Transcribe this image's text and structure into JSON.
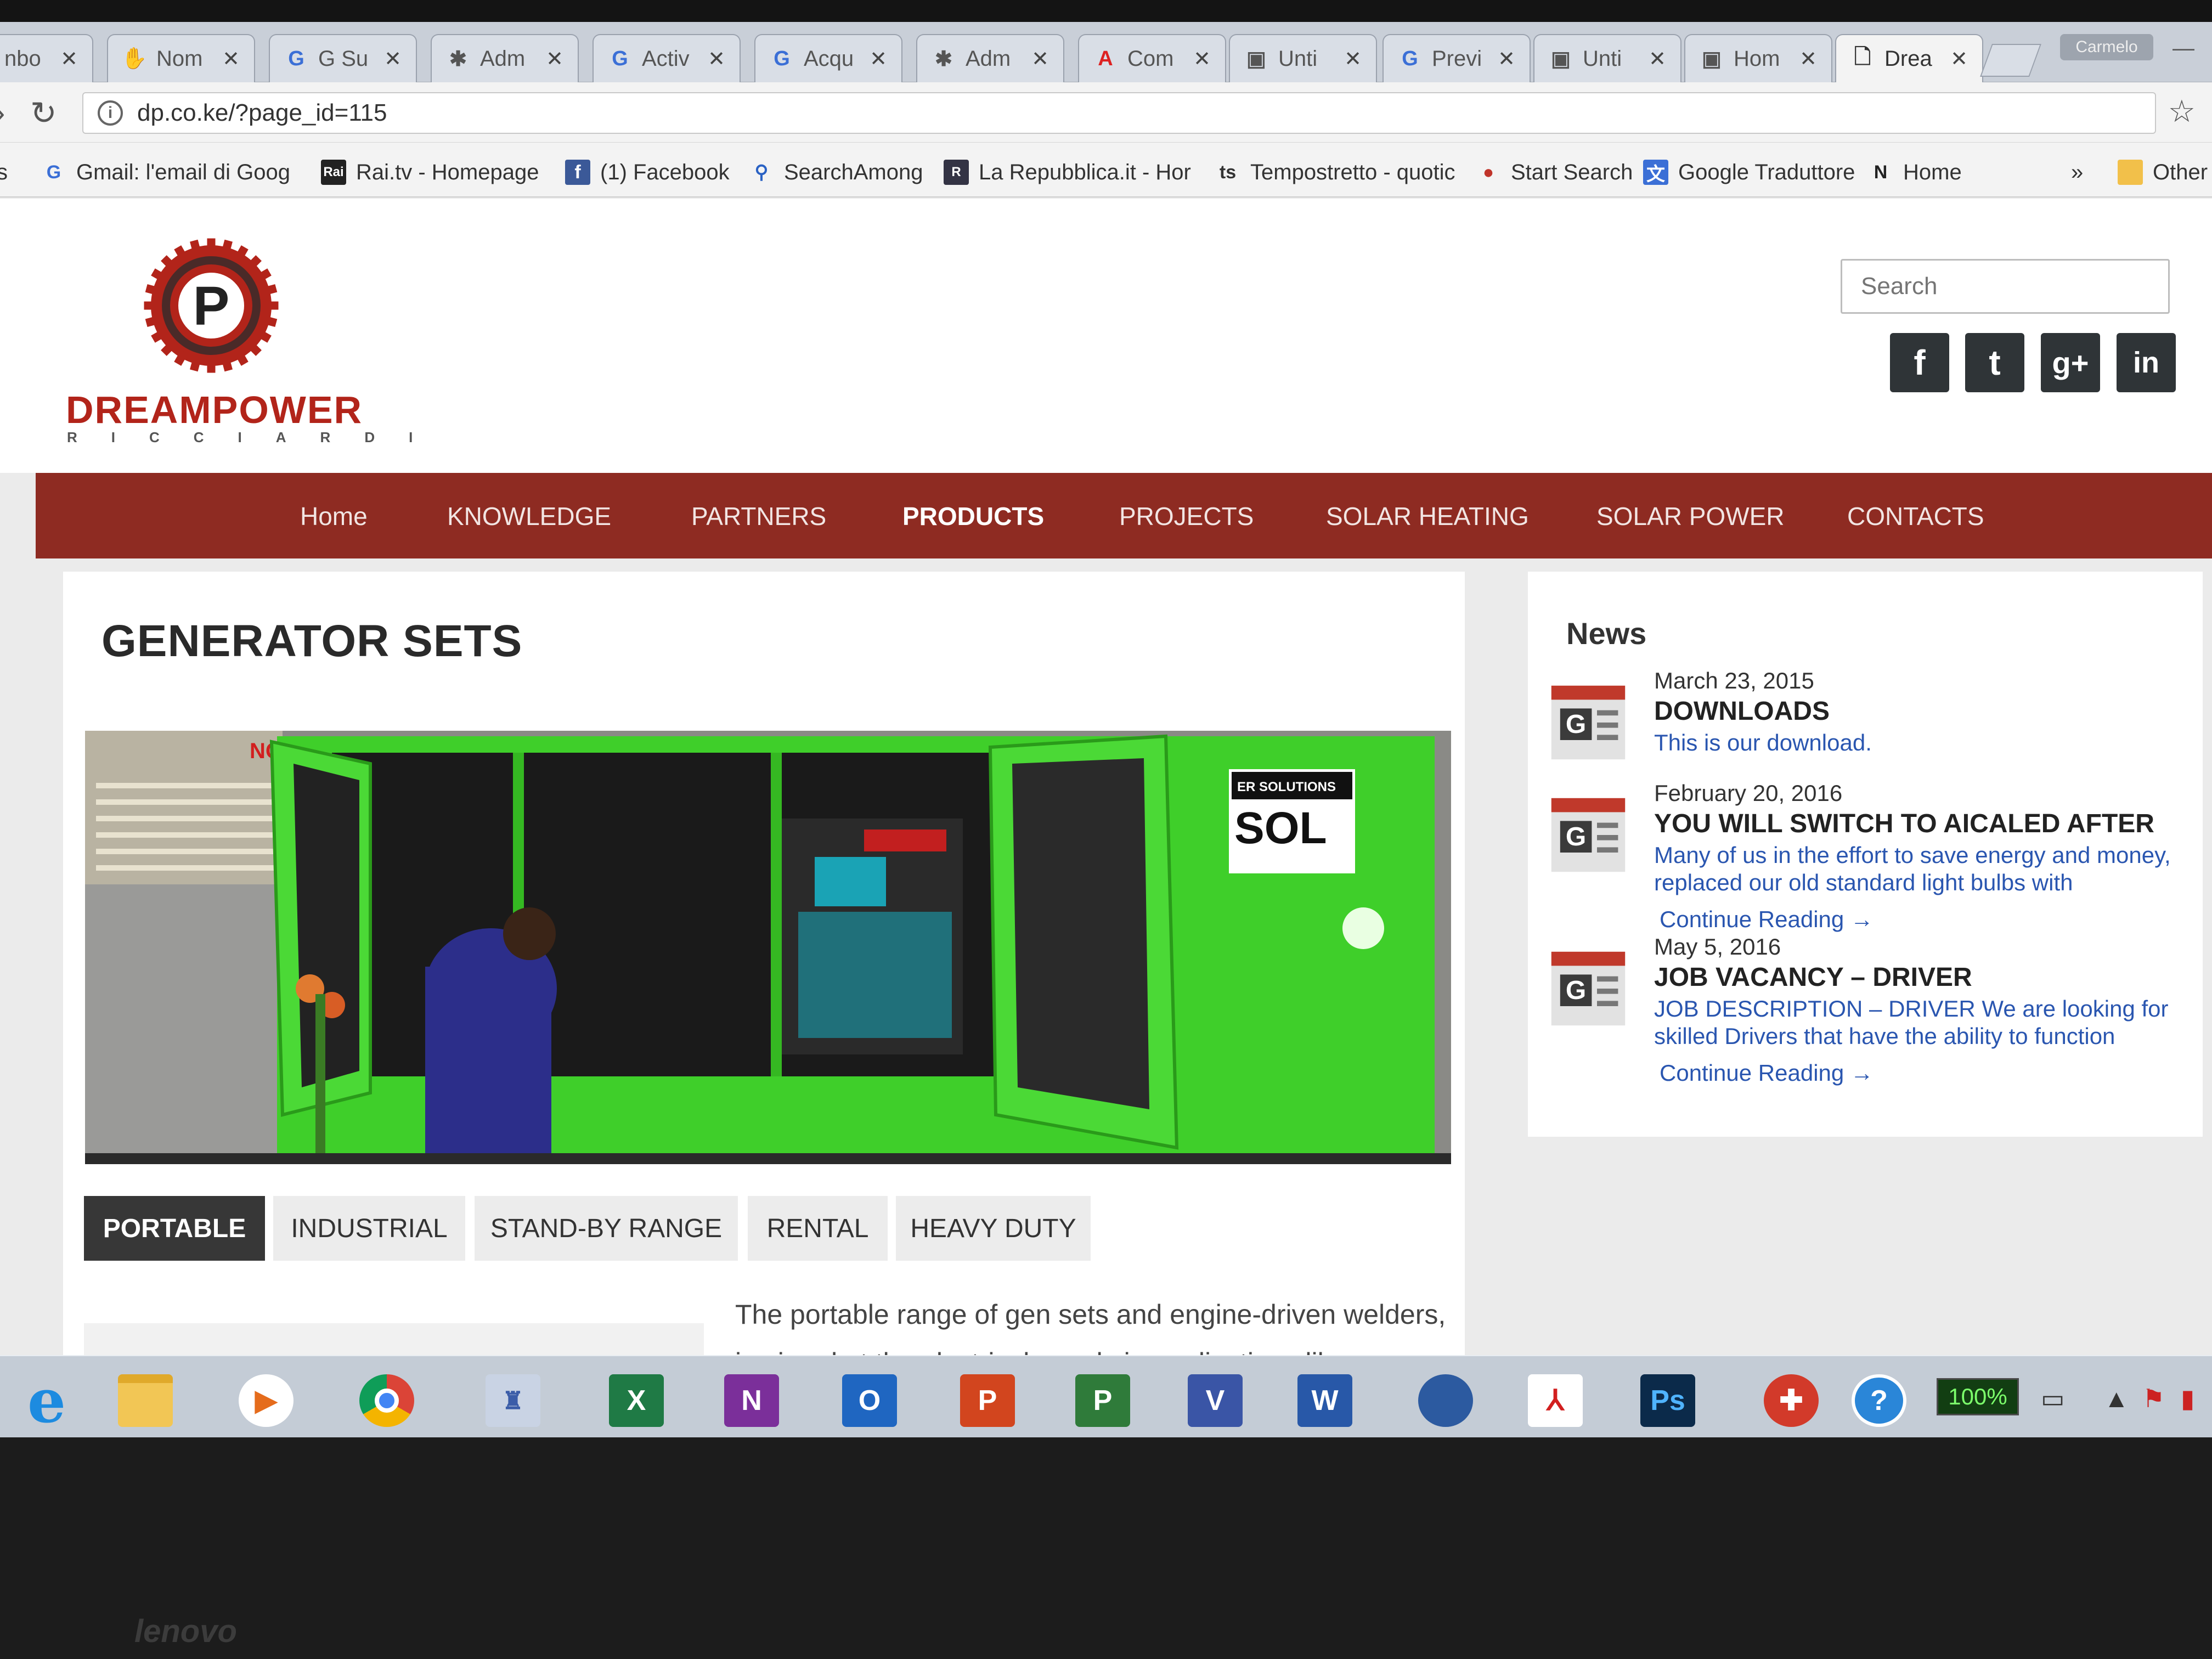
{
  "browser": {
    "tabs": [
      {
        "label": "nbo",
        "icon": "mail-icon"
      },
      {
        "label": "Nom",
        "icon": "puzzle-icon"
      },
      {
        "label": "G Su",
        "icon": "google-icon"
      },
      {
        "label": "Adm",
        "icon": "joomla-icon"
      },
      {
        "label": "Activ",
        "icon": "google-icon"
      },
      {
        "label": "Acqu",
        "icon": "google-icon"
      },
      {
        "label": "Adm",
        "icon": "joomla-icon"
      },
      {
        "label": "Com",
        "icon": "acrobat-icon"
      },
      {
        "label": "Unti",
        "icon": "page-icon"
      },
      {
        "label": "Previ",
        "icon": "google-icon"
      },
      {
        "label": "Unti",
        "icon": "page-icon"
      },
      {
        "label": "Hom",
        "icon": "page-icon"
      },
      {
        "label": "Drea",
        "icon": "document-icon"
      }
    ],
    "profile": "Carmelo",
    "url": "dp.co.ke/?page_id=115",
    "bookmarks": [
      {
        "label": "Gmail: l'email di Goog",
        "icon": "google-icon"
      },
      {
        "label": "Rai.tv - Homepage",
        "icon": "rai-icon"
      },
      {
        "label": "(1) Facebook",
        "icon": "facebook-icon"
      },
      {
        "label": "SearchAmong",
        "icon": "magnifier-icon"
      },
      {
        "label": "La Repubblica.it - Hor",
        "icon": "repubblica-icon"
      },
      {
        "label": "Tempostretto - quotic",
        "icon": "ts-icon"
      },
      {
        "label": "Start Search",
        "icon": "start-icon"
      },
      {
        "label": "Google Traduttore",
        "icon": "translate-icon"
      },
      {
        "label": "Home",
        "icon": "n-icon"
      },
      {
        "label": "Other",
        "icon": "folder-icon"
      }
    ],
    "apps_stub": "s",
    "overflow": "»"
  },
  "site": {
    "logo_text": "DREAMPOWER",
    "logo_sub": "RICCIARDI",
    "search_placeholder": "Search",
    "social": [
      "f",
      "t",
      "g+",
      "in"
    ],
    "nav": [
      "Home",
      "KNOWLEDGE",
      "PARTNERS",
      "PRODUCTS",
      "PROJECTS",
      "SOLAR HEATING",
      "SOLAR POWER",
      "CONTACTS"
    ],
    "page_title": "GENERATOR SETS",
    "hero_sign": "NO",
    "hero_brand_small": "ER SOLUTIONS",
    "hero_brand": "SOL",
    "product_tabs": [
      "PORTABLE",
      "INDUSTRIAL",
      "STAND-BY RANGE",
      "RENTAL",
      "HEAVY DUTY"
    ],
    "description_line1": "The portable range of gen sets and engine-driven welders,",
    "description_line2": "is aimed at the electrical supply in applications like"
  },
  "news": {
    "title": "News",
    "items": [
      {
        "date": "March 23, 2015",
        "headline": "DOWNLOADS",
        "excerpt": "This is our download.",
        "more": ""
      },
      {
        "date": "February 20, 2016",
        "headline": "YOU WILL SWITCH TO AICALED AFTER",
        "excerpt": "Many of us in the effort to save energy and money, replaced our old standard light bulbs with",
        "more": "Continue Reading →"
      },
      {
        "date": "May 5, 2016",
        "headline": "JOB VACANCY – DRIVER",
        "excerpt": "JOB DESCRIPTION – DRIVER   We are looking for skilled Drivers that have the ability to function",
        "more": "Continue Reading →"
      }
    ]
  },
  "taskbar": {
    "apps": [
      "internet-explorer",
      "file-explorer",
      "media-player",
      "chrome",
      "app",
      "excel",
      "onenote",
      "outlook",
      "powerpoint",
      "project",
      "visio",
      "word",
      "thunderbird",
      "acrobat",
      "photoshop",
      "office-alert",
      "help"
    ],
    "app_letters": {
      "excel": "X",
      "onenote": "N",
      "outlook": "O",
      "powerpoint": "P",
      "project": "P",
      "visio": "V",
      "word": "W",
      "photoshop": "Ps",
      "help": "?"
    },
    "battery": "100%"
  },
  "device_brand": "lenovo",
  "colors": {
    "brand_red": "#8e2b22",
    "logo_red": "#b2241a",
    "link_blue": "#2a56b0",
    "generator_green": "#3fcf2a"
  }
}
